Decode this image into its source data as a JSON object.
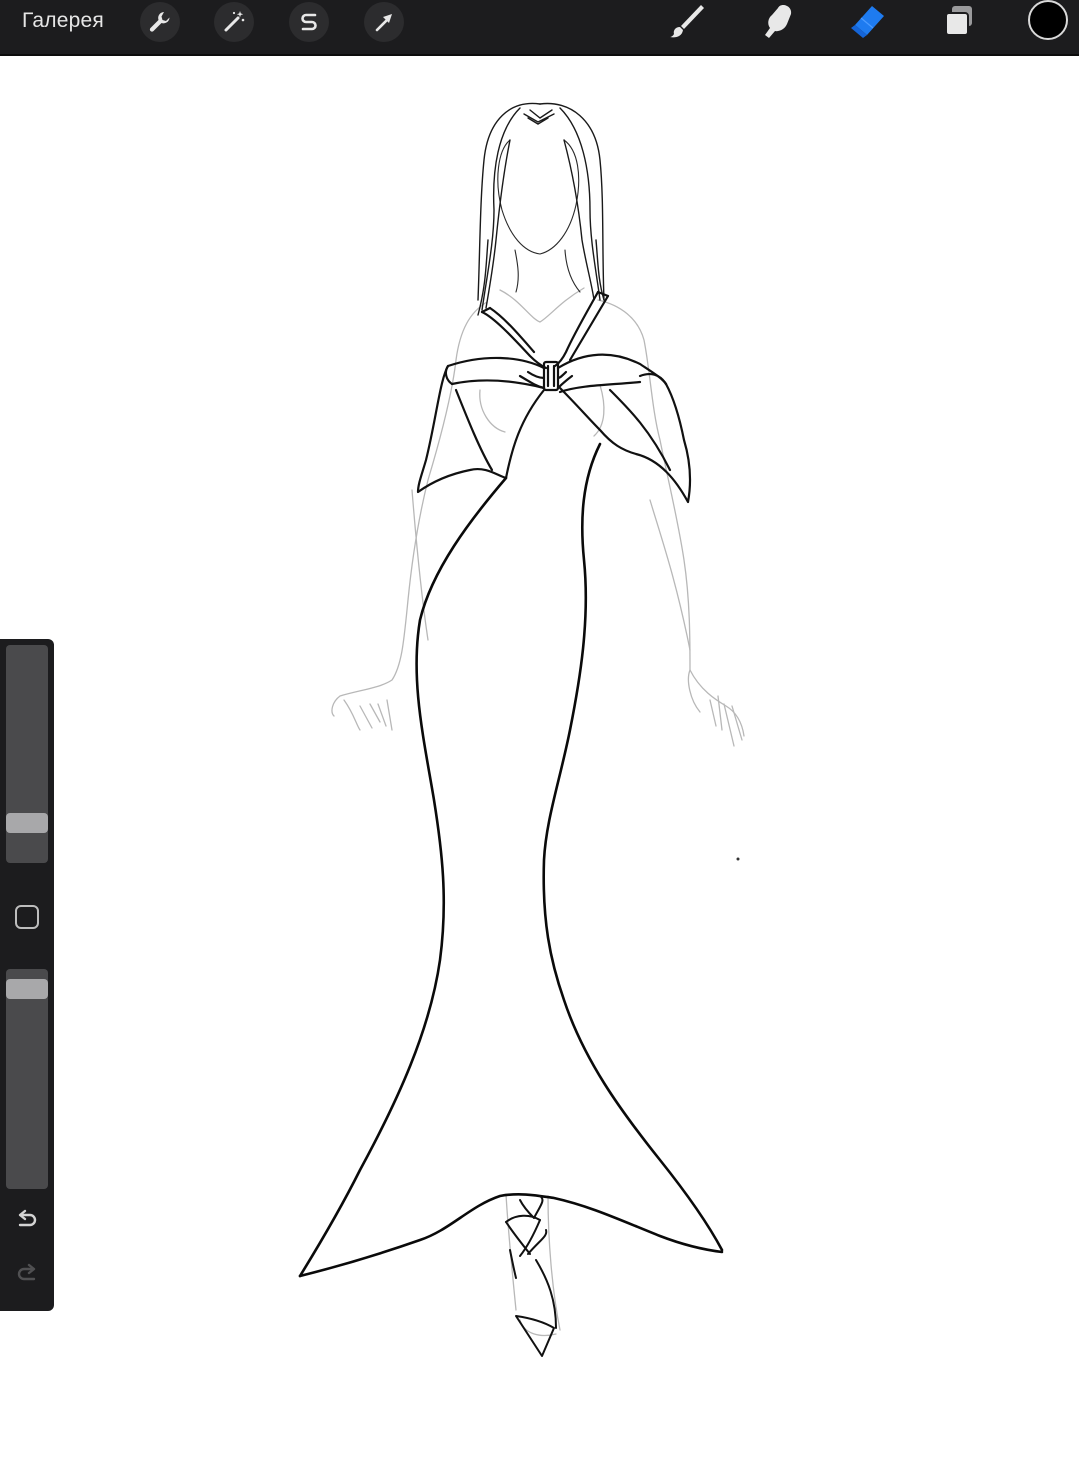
{
  "toolbar": {
    "gallery_label": "Галерея",
    "left_tools": [
      {
        "name": "actions",
        "icon": "wrench-icon"
      },
      {
        "name": "adjustments",
        "icon": "magic-wand-icon"
      },
      {
        "name": "selection",
        "icon": "selection-s-icon"
      },
      {
        "name": "transform",
        "icon": "arrow-cursor-icon"
      }
    ],
    "right_tools": [
      {
        "name": "brush",
        "icon": "brush-icon",
        "active": false
      },
      {
        "name": "smudge",
        "icon": "smudge-finger-icon",
        "active": false
      },
      {
        "name": "eraser",
        "icon": "eraser-icon",
        "active": true
      },
      {
        "name": "layers",
        "icon": "layers-icon",
        "active": false
      }
    ],
    "current_color": "#000000",
    "active_color": "#1e7bf0",
    "icon_color": "#e8e8e8"
  },
  "sidebar": {
    "brush_size_level": 0.15,
    "opacity_level": 0.95,
    "modify_icon": "square-icon",
    "undo_icon": "undo-arrow-icon",
    "redo_icon": "redo-arrow-icon",
    "redo_enabled": false
  },
  "canvas": {
    "background": "#ffffff",
    "content": "fashion-sketch-gown-drawing"
  }
}
